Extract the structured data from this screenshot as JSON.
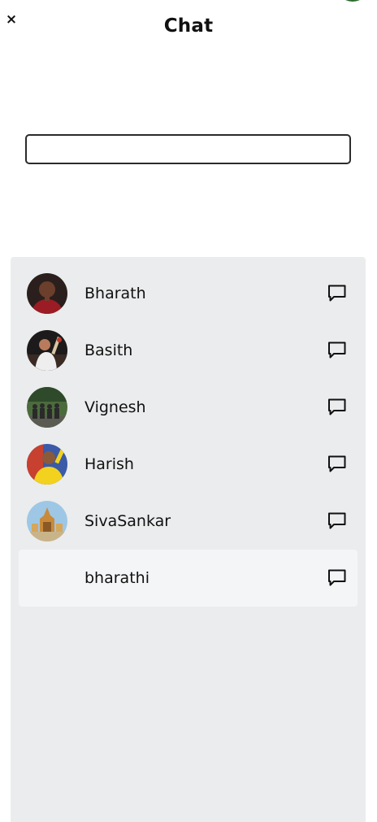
{
  "header": {
    "title": "Chat",
    "close_icon": "×"
  },
  "search": {
    "value": "",
    "placeholder": ""
  },
  "contacts": [
    {
      "name": "Bharath",
      "avatar": "photo-red-shirt",
      "active": false
    },
    {
      "name": "Basith",
      "avatar": "photo-cricketer",
      "active": false
    },
    {
      "name": "Vignesh",
      "avatar": "photo-group",
      "active": false
    },
    {
      "name": "Harish",
      "avatar": "photo-yellow-jersey",
      "active": false
    },
    {
      "name": "SivaSankar",
      "avatar": "photo-temple",
      "active": false
    },
    {
      "name": "bharathi",
      "avatar": "none",
      "active": true
    }
  ],
  "icons": {
    "chat": "message-square-icon",
    "close": "close-icon"
  },
  "colors": {
    "panel": "#ebeced",
    "active_row": "#f4f5f6",
    "text": "#111111"
  }
}
